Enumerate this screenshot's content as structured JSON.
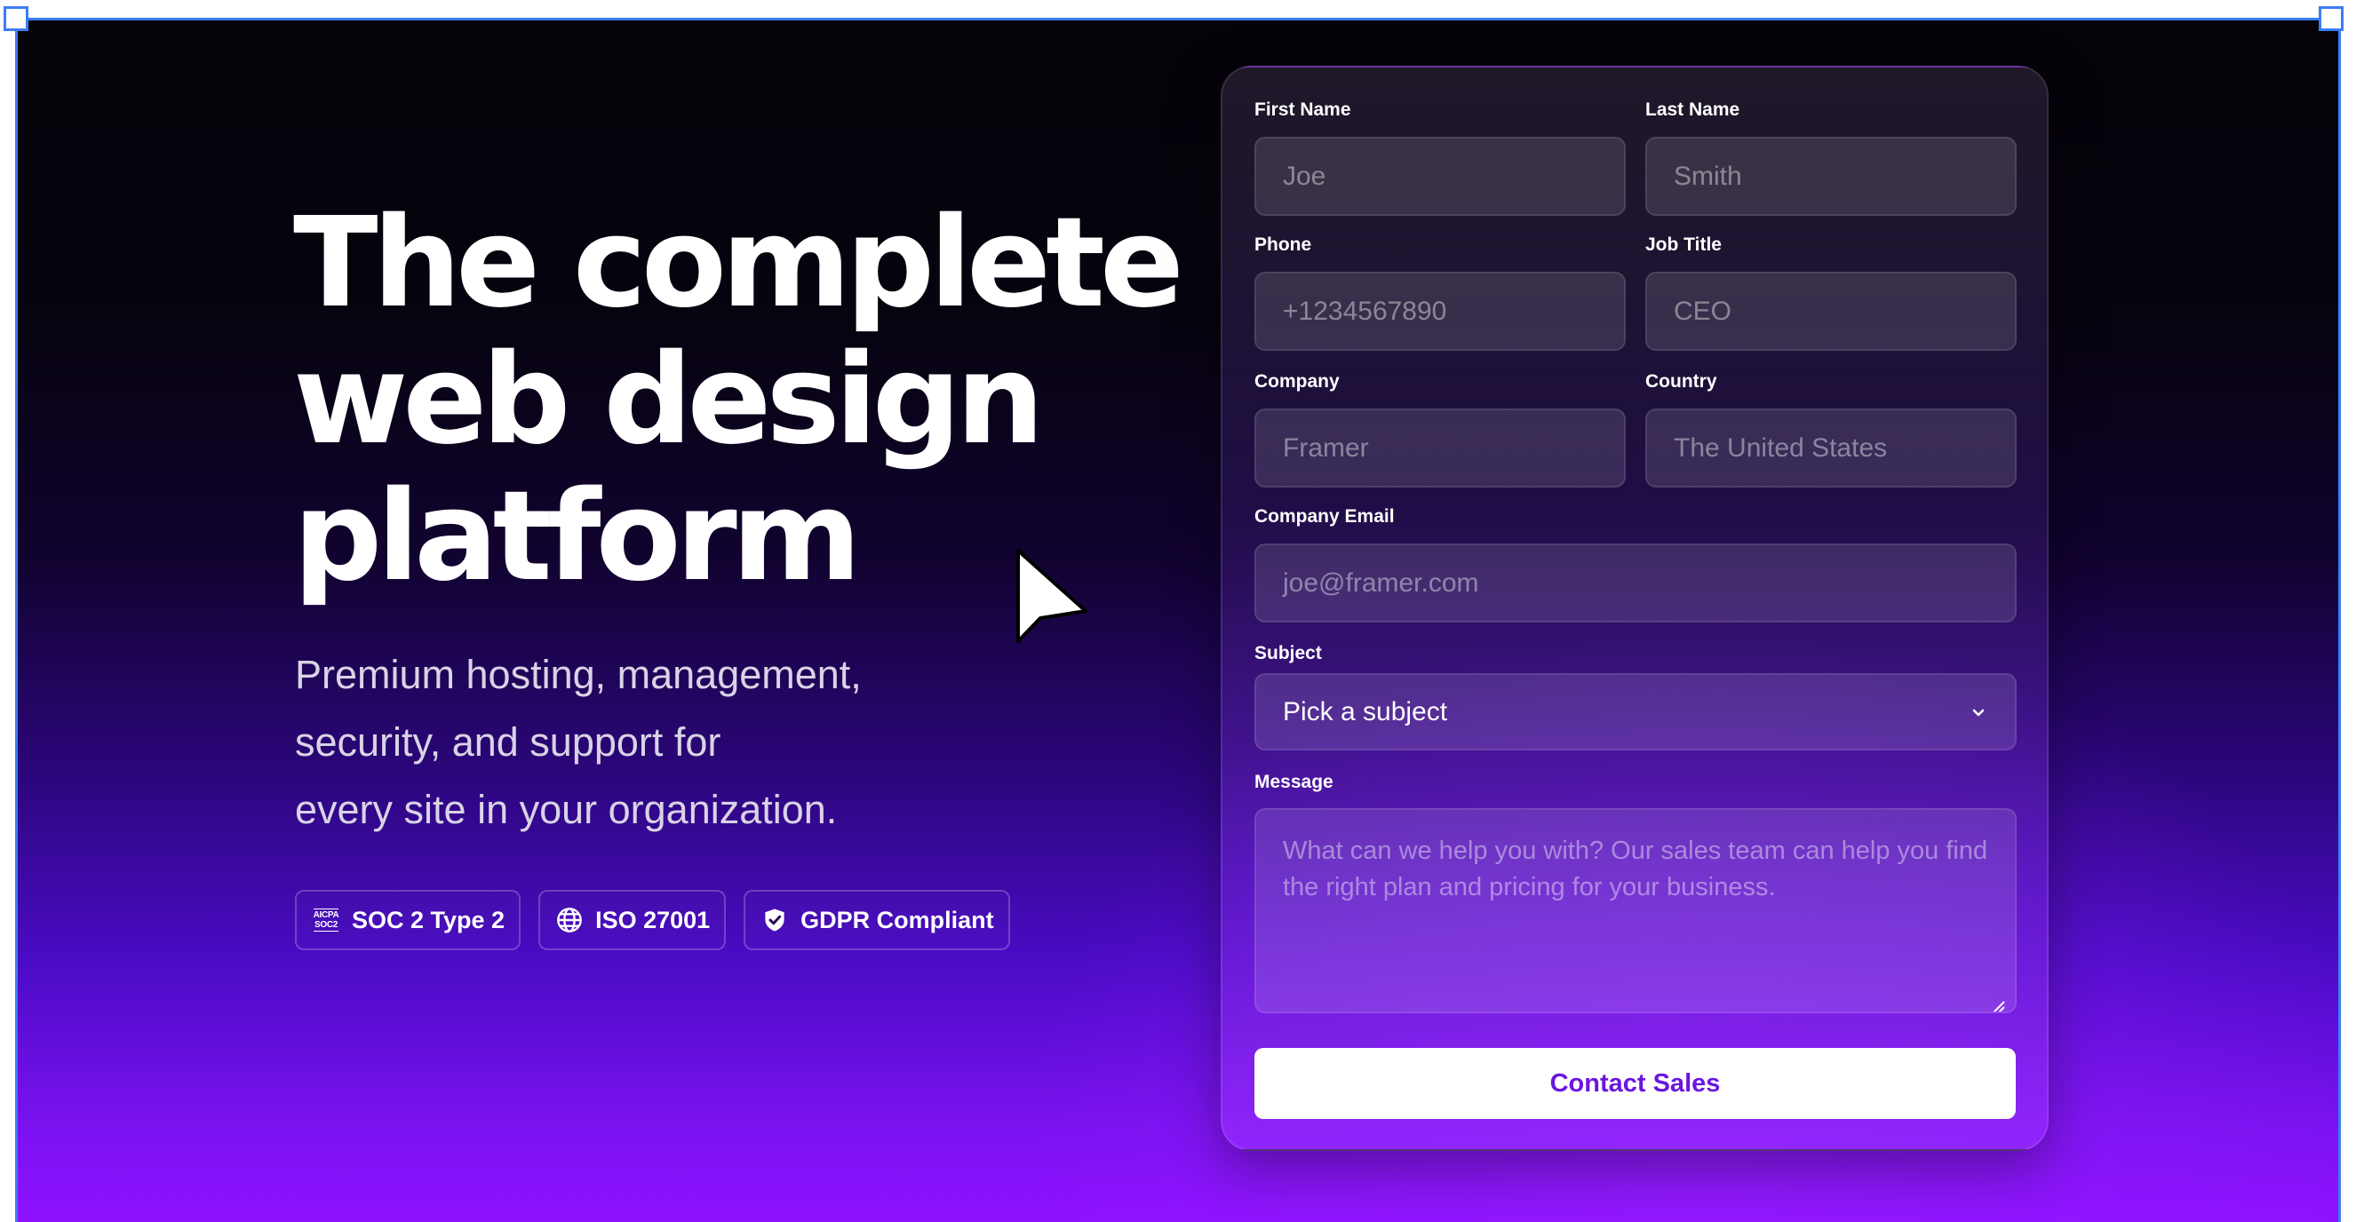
{
  "hero": {
    "title_lines": [
      "The complete",
      "web design",
      "platform"
    ],
    "subtitle_lines": [
      "Premium hosting, management,",
      "security, and support for",
      "every site in your organization."
    ],
    "badges": [
      {
        "icon": "aicpa-soc2-icon",
        "icon_text_top": "AICPA",
        "icon_text_bottom": "SOC2",
        "label": "SOC 2 Type 2"
      },
      {
        "icon": "globe-icon",
        "label": "ISO 27001"
      },
      {
        "icon": "shield-check-icon",
        "label": "GDPR Compliant"
      }
    ]
  },
  "form": {
    "first_name": {
      "label": "First Name",
      "placeholder": "Joe"
    },
    "last_name": {
      "label": "Last Name",
      "placeholder": "Smith"
    },
    "phone": {
      "label": "Phone",
      "placeholder": "+1234567890"
    },
    "job_title": {
      "label": "Job Title",
      "placeholder": "CEO"
    },
    "company": {
      "label": "Company",
      "placeholder": "Framer"
    },
    "country": {
      "label": "Country",
      "placeholder": "The United States"
    },
    "company_email": {
      "label": "Company Email",
      "placeholder": "joe@framer.com"
    },
    "subject": {
      "label": "Subject",
      "value": "Pick a subject",
      "icon": "chevron-down-icon"
    },
    "message": {
      "label": "Message",
      "placeholder": "What can we help you with? Our sales team can help you find the right plan and pricing for your business."
    },
    "submit_label": "Contact Sales"
  },
  "colors": {
    "accent": "#6a16e0",
    "selection": "#3b7cf4",
    "gradient_bottom": "#8f12ff"
  },
  "cursor": {
    "icon": "mouse-pointer-icon"
  }
}
